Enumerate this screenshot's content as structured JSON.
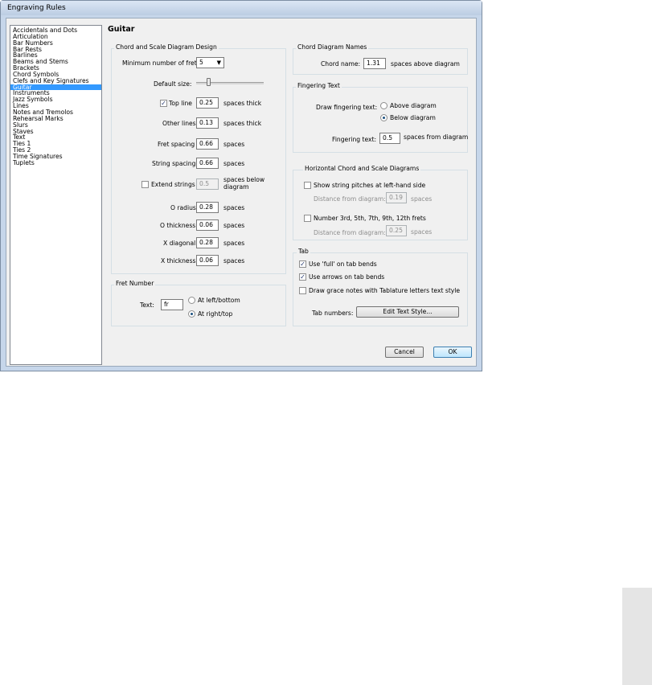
{
  "window": {
    "title": "Engraving Rules"
  },
  "categories": [
    "Accidentals and Dots",
    "Articulation",
    "Bar Numbers",
    "Bar Rests",
    "Barlines",
    "Beams and Stems",
    "Brackets",
    "Chord Symbols",
    "Clefs and Key Signatures",
    "Guitar",
    "Instruments",
    "Jazz Symbols",
    "Lines",
    "Notes and Tremolos",
    "Rehearsal Marks",
    "Slurs",
    "Staves",
    "Text",
    "Ties 1",
    "Ties 2",
    "Time Signatures",
    "Tuplets"
  ],
  "selected_category": "Guitar",
  "page_title": "Guitar",
  "chord_scale": {
    "title": "Chord and Scale Diagram Design",
    "min_frets_label": "Minimum number of frets",
    "min_frets_value": "5",
    "default_size_label": "Default size:",
    "top_line_label": "Top line",
    "top_line_value": "0.25",
    "top_line_unit": "spaces thick",
    "other_lines_label": "Other lines",
    "other_lines_value": "0.13",
    "other_lines_unit": "spaces thick",
    "fret_spacing_label": "Fret spacing",
    "fret_spacing_value": "0.66",
    "fret_spacing_unit": "spaces",
    "string_spacing_label": "String spacing",
    "string_spacing_value": "0.66",
    "string_spacing_unit": "spaces",
    "extend_strings_label": "Extend strings",
    "extend_strings_value": "0.5",
    "extend_strings_unit_1": "spaces below",
    "extend_strings_unit_2": "diagram",
    "o_radius_label": "O radius",
    "o_radius_value": "0.28",
    "o_radius_unit": "spaces",
    "o_thickness_label": "O thickness",
    "o_thickness_value": "0.06",
    "o_thickness_unit": "spaces",
    "x_diagonal_label": "X diagonal",
    "x_diagonal_value": "0.28",
    "x_diagonal_unit": "spaces",
    "x_thickness_label": "X thickness",
    "x_thickness_value": "0.06",
    "x_thickness_unit": "spaces"
  },
  "fret_number": {
    "title": "Fret Number",
    "text_label": "Text:",
    "text_value": "fr",
    "left_bottom_label": "At left/bottom",
    "right_top_label": "At right/top"
  },
  "chord_names": {
    "title": "Chord Diagram Names",
    "chord_name_label": "Chord name:",
    "chord_name_value": "1.31",
    "chord_name_unit": "spaces above diagram"
  },
  "fingering": {
    "title": "Fingering Text",
    "draw_label": "Draw fingering text:",
    "above_label": "Above diagram",
    "below_label": "Below diagram",
    "fingering_text_label": "Fingering text:",
    "fingering_text_value": "0.5",
    "fingering_text_unit": "spaces from diagram"
  },
  "horizontal": {
    "title": "Horizontal Chord and Scale Diagrams",
    "show_pitches_label": "Show string pitches at left-hand side",
    "distance1_label": "Distance from diagram:",
    "distance1_value": "0.19",
    "distance1_unit": "spaces",
    "number_frets_label": "Number 3rd, 5th, 7th, 9th, 12th frets",
    "distance2_label": "Distance from diagram:",
    "distance2_value": "0.25",
    "distance2_unit": "spaces"
  },
  "tab": {
    "title": "Tab",
    "full_label": "Use 'full' on tab bends",
    "arrows_label": "Use arrows on tab bends",
    "grace_label": "Draw grace notes with Tablature letters text style",
    "tab_numbers_label": "Tab numbers:",
    "edit_text_style_label": "Edit Text Style..."
  },
  "buttons": {
    "cancel": "Cancel",
    "ok": "OK"
  }
}
